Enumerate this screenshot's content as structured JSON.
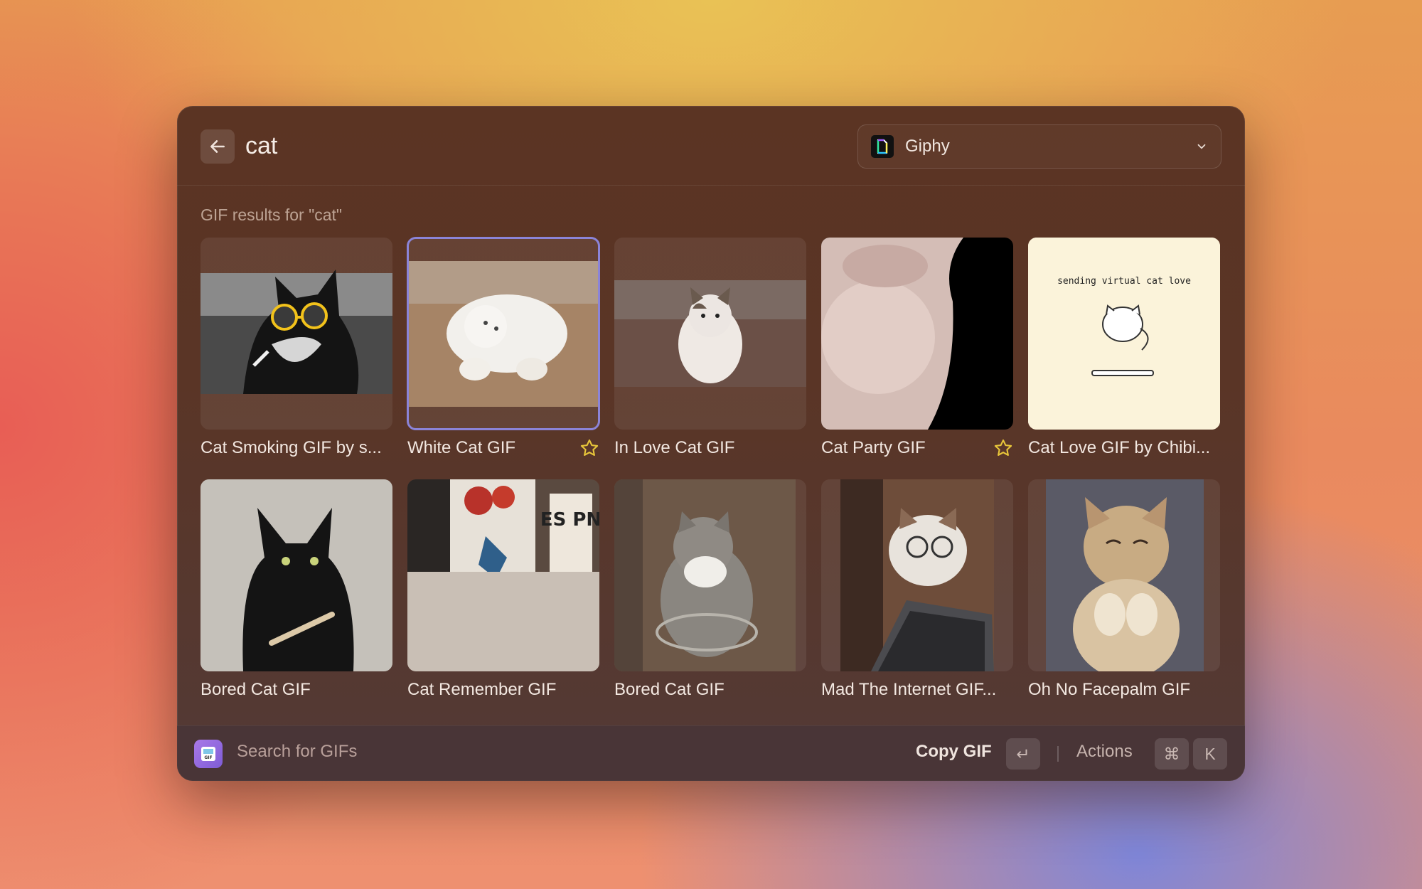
{
  "search": {
    "query": "cat",
    "placeholder": "Search GIFs"
  },
  "source": {
    "label": "Giphy",
    "icon": "giphy-logo-icon"
  },
  "section": {
    "title": "GIF results for \"cat\""
  },
  "gifs": [
    {
      "title": "Cat Smoking GIF by s...",
      "favorite": false,
      "selected": false
    },
    {
      "title": "White Cat GIF",
      "favorite": true,
      "selected": true
    },
    {
      "title": "In Love Cat GIF",
      "favorite": false,
      "selected": false
    },
    {
      "title": "Cat Party GIF",
      "favorite": true,
      "selected": false
    },
    {
      "title": "Cat Love GIF by Chibi...",
      "favorite": false,
      "selected": false,
      "image_text": "sending virtual cat love"
    },
    {
      "title": "Bored Cat GIF",
      "favorite": false,
      "selected": false
    },
    {
      "title": "Cat Remember GIF",
      "favorite": false,
      "selected": false,
      "image_text": "ES PN"
    },
    {
      "title": "Bored Cat GIF",
      "favorite": false,
      "selected": false
    },
    {
      "title": "Mad The Internet GIF...",
      "favorite": false,
      "selected": false
    },
    {
      "title": "Oh No Facepalm GIF",
      "favorite": false,
      "selected": false
    }
  ],
  "footer": {
    "title": "Search for GIFs",
    "primary_action": "Copy GIF",
    "enter_key": "↵",
    "actions_label": "Actions",
    "cmd_key": "⌘",
    "k_key": "K"
  },
  "colors": {
    "selection": "#8b84d8",
    "star": "#e8c63a",
    "window": "#5b3423"
  }
}
